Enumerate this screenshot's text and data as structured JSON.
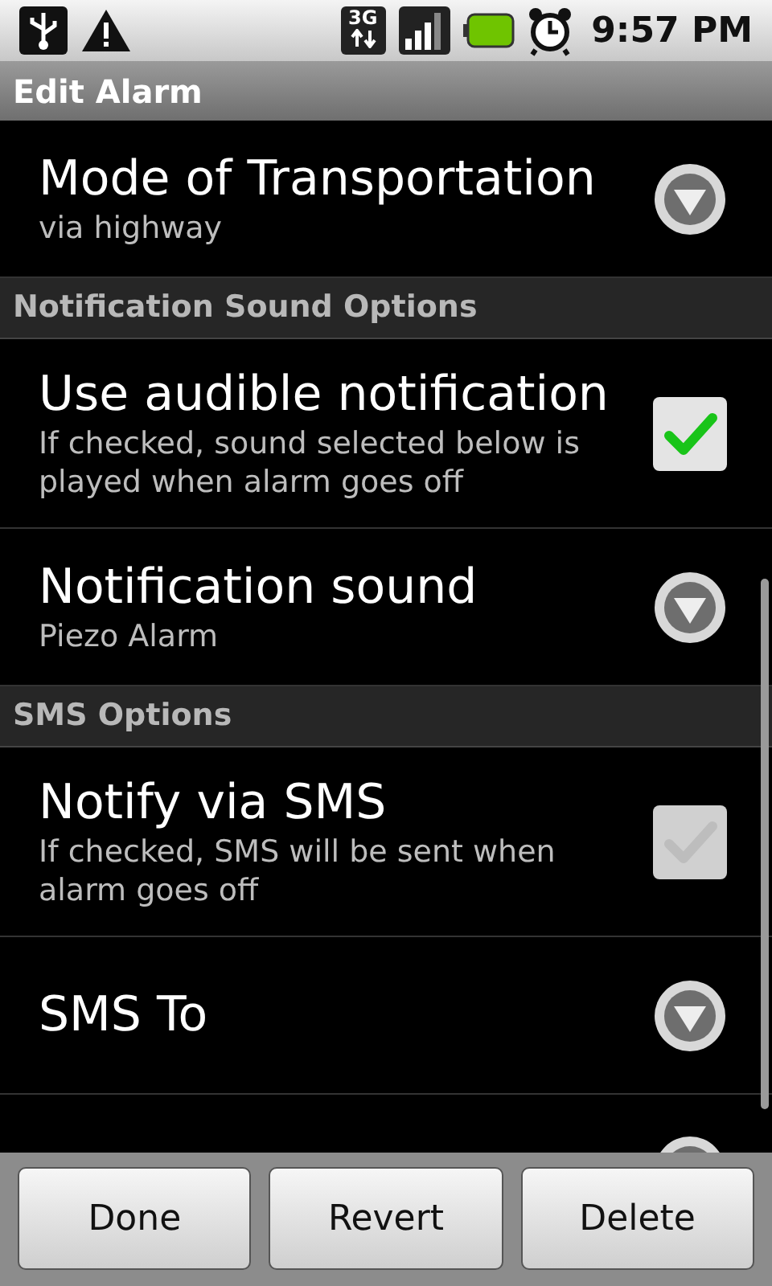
{
  "status_bar": {
    "time": "9:57 PM",
    "network": "3G"
  },
  "title_bar": {
    "title": "Edit Alarm"
  },
  "list": [
    {
      "kind": "dropdown",
      "title": "Mode of Transportation",
      "summary": "via highway"
    },
    {
      "kind": "header",
      "title": "Notification Sound Options"
    },
    {
      "kind": "checkbox",
      "title": "Use audible notification",
      "summary": "If checked, sound selected below is played when alarm goes off",
      "checked": true
    },
    {
      "kind": "dropdown",
      "title": "Notification sound",
      "summary": "Piezo Alarm"
    },
    {
      "kind": "header",
      "title": "SMS Options"
    },
    {
      "kind": "checkbox",
      "title": "Notify via SMS",
      "summary": "If checked, SMS will be sent when alarm goes off",
      "checked": false
    },
    {
      "kind": "dropdown",
      "title": "SMS To"
    },
    {
      "kind": "partial"
    }
  ],
  "buttons": [
    "Done",
    "Revert",
    "Delete"
  ]
}
